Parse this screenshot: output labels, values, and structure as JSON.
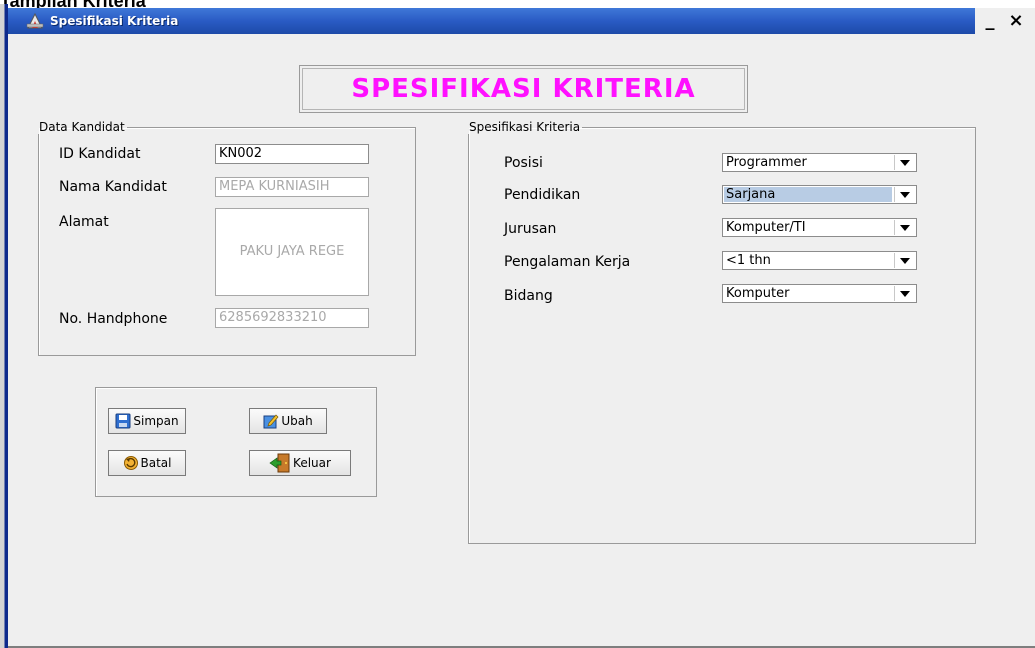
{
  "document_caption": "Tampilan Kriteria",
  "window": {
    "title": "Spesifikasi Kriteria",
    "minimize_glyph": "_",
    "close_glyph": "×"
  },
  "header": {
    "title": "SPESIFIKASI KRITERIA"
  },
  "data_kandidat": {
    "legend": "Data Kandidat",
    "id_label": "ID Kandidat",
    "id_value": "KN002",
    "nama_label": "Nama Kandidat",
    "nama_value": "MEPA KURNIASIH",
    "alamat_label": "Alamat",
    "alamat_value": "PAKU JAYA REGE",
    "hp_label": "No. Handphone",
    "hp_value": "6285692833210"
  },
  "spesifikasi": {
    "legend": "Spesifikasi Kriteria",
    "rows": [
      {
        "label": "Posisi",
        "value": "Programmer",
        "selected": false
      },
      {
        "label": "Pendidikan",
        "value": "Sarjana",
        "selected": true
      },
      {
        "label": "Jurusan",
        "value": "Komputer/TI",
        "selected": false
      },
      {
        "label": "Pengalaman Kerja",
        "value": "<1 thn",
        "selected": false
      },
      {
        "label": "Bidang",
        "value": "Komputer",
        "selected": false
      }
    ]
  },
  "buttons": {
    "simpan": "Simpan",
    "ubah": "Ubah",
    "batal": "Batal",
    "keluar": "Keluar"
  },
  "colors": {
    "title_bar": "#2a5bc4",
    "header_text": "#ff10ff",
    "selected_combo_bg": "#b8cce4"
  },
  "icons": [
    "app-icon",
    "save-icon",
    "edit-icon",
    "cancel-icon",
    "exit-icon",
    "chevron-down-icon"
  ]
}
